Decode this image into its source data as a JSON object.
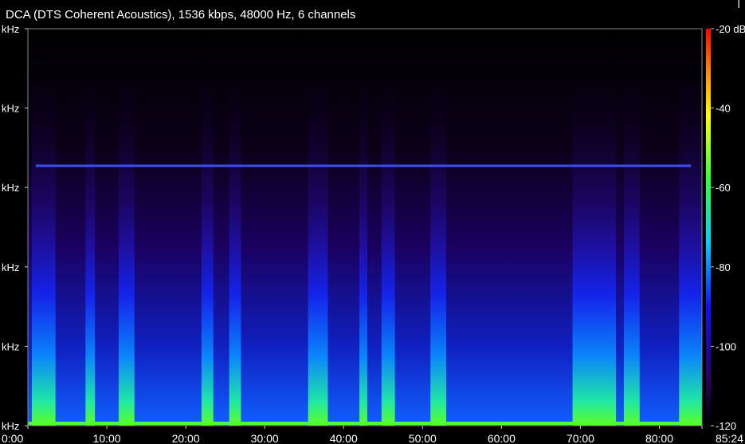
{
  "title": "DCA (DTS Coherent Acoustics), 1536 kbps, 48000 Hz, 6 channels",
  "corner_mark": "|",
  "chart_data": {
    "type": "heatmap",
    "title": "DCA (DTS Coherent Acoustics), 1536 kbps, 48000 Hz, 6 channels",
    "x_axis": {
      "unit": "mm:ss",
      "range_minutes": [
        0,
        85.4
      ],
      "ticks": [
        {
          "label": "0:00",
          "value": 0
        },
        {
          "label": "10:00",
          "value": 10
        },
        {
          "label": "20:00",
          "value": 20
        },
        {
          "label": "30:00",
          "value": 30
        },
        {
          "label": "40:00",
          "value": 40
        },
        {
          "label": "50:00",
          "value": 50
        },
        {
          "label": "60:00",
          "value": 60
        },
        {
          "label": "70:00",
          "value": 70
        },
        {
          "label": "80:00",
          "value": 80
        },
        {
          "label": "85:24",
          "value": 85.4
        }
      ]
    },
    "y_axis": {
      "unit": "kHz",
      "ticks": [
        "kHz",
        "kHz",
        "kHz",
        "kHz",
        "kHz",
        "kHz"
      ]
    },
    "colorbar": {
      "unit": "dB",
      "range": [
        -120,
        -20
      ],
      "ticks": [
        {
          "label": "-20 dB",
          "value": -20
        },
        {
          "label": "-40",
          "value": -40
        },
        {
          "label": "-60",
          "value": -60
        },
        {
          "label": "-80",
          "value": -80
        },
        {
          "label": "-100",
          "value": -100
        },
        {
          "label": "-120",
          "value": -120
        }
      ],
      "colors": [
        "#000000",
        "#2a0060",
        "#1010ff",
        "#00d0ff",
        "#30ff40",
        "#ffff00",
        "#ff8000",
        "#ff0000"
      ]
    },
    "loud_segments_minutes": [
      [
        0.5,
        3.5
      ],
      [
        7.3,
        8.5
      ],
      [
        11.5,
        13.5
      ],
      [
        22,
        23.5
      ],
      [
        25.5,
        27
      ],
      [
        35.5,
        38
      ],
      [
        42,
        43
      ],
      [
        44.8,
        46.5
      ],
      [
        51,
        53
      ],
      [
        69,
        74.5
      ],
      [
        75.5,
        77.5
      ],
      [
        82.5,
        85.4
      ]
    ],
    "tone_line_minutes": [
      1,
      84
    ],
    "background_level_db": -102
  }
}
